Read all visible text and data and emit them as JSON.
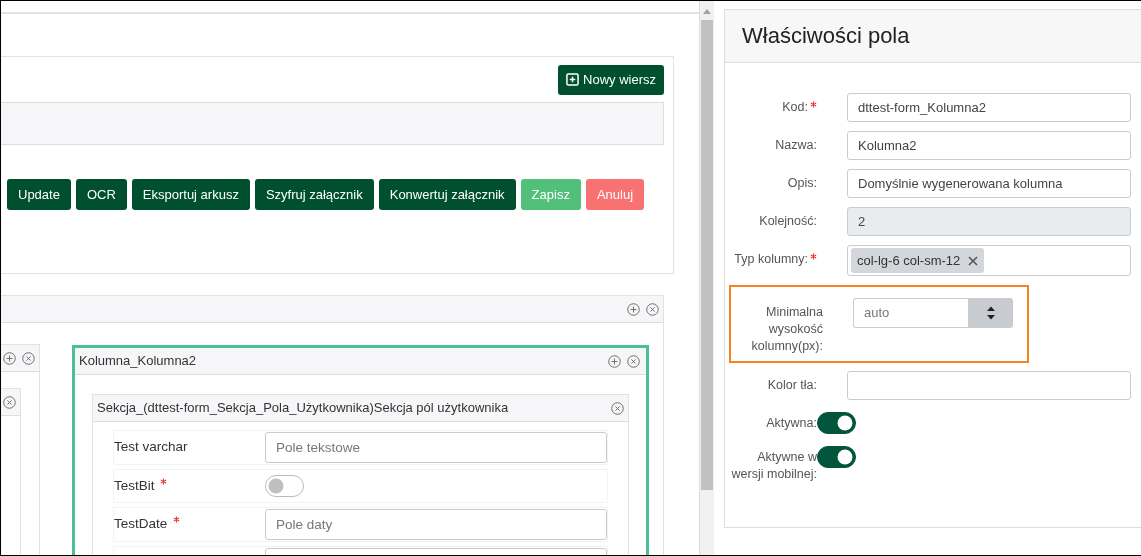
{
  "toolbar": {
    "new_row_button": "Nowy wiersz"
  },
  "actions": [
    {
      "label": "Update",
      "kind": "primary"
    },
    {
      "label": "OCR",
      "kind": "primary"
    },
    {
      "label": "Eksportuj arkusz",
      "kind": "primary"
    },
    {
      "label": "Szyfruj załącznik",
      "kind": "primary"
    },
    {
      "label": "Konwertuj załącznik",
      "kind": "primary"
    },
    {
      "label": "Zapisz",
      "kind": "success"
    },
    {
      "label": "Anuluj",
      "kind": "danger"
    }
  ],
  "column": {
    "title": "Kolumna_Kolumna2",
    "selected": true
  },
  "section": {
    "title": "Sekcja_(dttest-form_Sekcja_Pola_Użytkownika)Sekcja pól użytkownika",
    "fields": [
      {
        "label": "Test varchar",
        "required": false,
        "kind": "text",
        "placeholder": "Pole tekstowe"
      },
      {
        "label": "TestBit",
        "required": true,
        "kind": "switch",
        "on": false
      },
      {
        "label": "TestDate",
        "required": true,
        "kind": "text",
        "placeholder": "Pole daty"
      },
      {
        "kind": "text"
      }
    ]
  },
  "properties": {
    "title": "Właściwości pola",
    "fields": [
      {
        "label": "Kod:",
        "required": true,
        "disabled": false,
        "kind": "text",
        "value": "dttest-form_Kolumna2"
      },
      {
        "label": "Nazwa:",
        "required": false,
        "disabled": false,
        "kind": "text",
        "value": "Kolumna2"
      },
      {
        "label": "Opis:",
        "required": false,
        "disabled": false,
        "kind": "text",
        "value": "Domyślnie wygenerowana kolumna"
      },
      {
        "label": "Kolejność:",
        "required": false,
        "disabled": true,
        "kind": "text",
        "value": "2"
      },
      {
        "label": "Typ kolumny:",
        "required": true,
        "kind": "tags",
        "tags": [
          "col-lg-6 col-sm-12"
        ]
      },
      {
        "label": "Minimalna wysokość kolumny(px):",
        "required": false,
        "kind": "number",
        "placeholder": "auto",
        "highlighted": true
      },
      {
        "label": "Kolor tła:",
        "required": false,
        "disabled": false,
        "kind": "text"
      },
      {
        "label": "Aktywna:",
        "required": false,
        "disabled": false,
        "kind": "switch",
        "on": true
      },
      {
        "label": "Aktywne w wersji mobilnej:",
        "required": false,
        "disabled": false,
        "kind": "switch",
        "on": true
      }
    ]
  }
}
